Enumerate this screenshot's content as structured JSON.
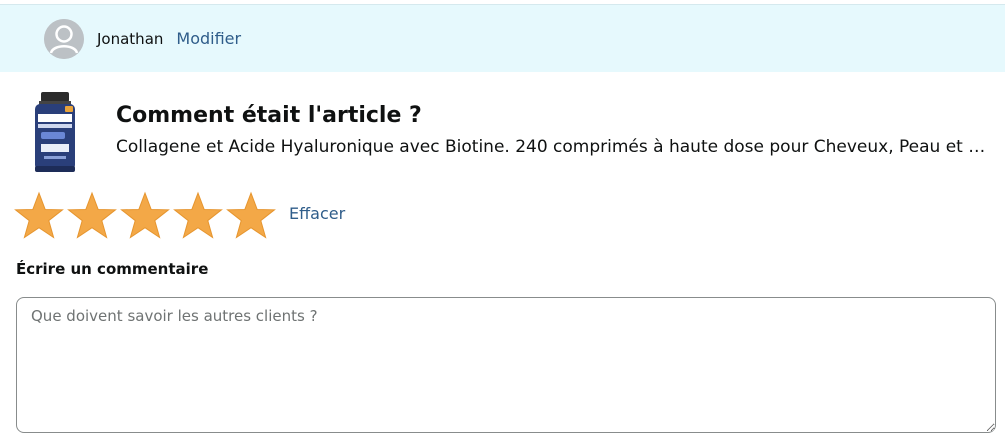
{
  "user": {
    "name": "Jonathan",
    "edit_label": "Modifier"
  },
  "product": {
    "question": "Comment était l'article ?",
    "title": "Collagene et Acide Hyaluronique avec Biotine. 240 comprimés à haute dose pour Cheveux, Peau et Ongles",
    "image_text": [
      "COLLAGÈNE",
      "ACIDE HYALURONIQUE",
      "BIOTINE"
    ]
  },
  "rating": {
    "value": 5,
    "max": 5,
    "star_color": "#f3a847",
    "clear_label": "Effacer"
  },
  "comment": {
    "label": "Écrire un commentaire",
    "placeholder": "Que doivent savoir les autres clients ?",
    "value": ""
  },
  "colors": {
    "top_bar_bg": "#e6f9fd",
    "link": "#2f5d8a"
  }
}
